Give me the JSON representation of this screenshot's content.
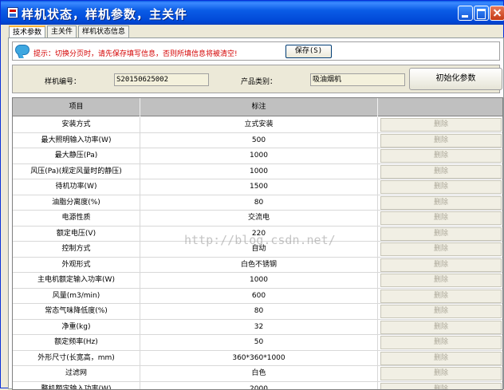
{
  "window": {
    "title": "样机状态，样机参数，主关件"
  },
  "tabs": [
    {
      "label": "技术参数"
    },
    {
      "label": "主关件"
    },
    {
      "label": "样机状态信息"
    }
  ],
  "notice": {
    "text": "提示：切换分页时，请先保存填写信息，否则所填信息将被清空!",
    "save_label": "保存(S)"
  },
  "info": {
    "sample_label": "样机编号：",
    "sample_value": "S20150625002",
    "type_label": "产品类别：",
    "type_value": "吸油烟机",
    "init_label": "初始化参数"
  },
  "table": {
    "headers": [
      "项目",
      "标注",
      ""
    ],
    "delete_label": "删除",
    "rows": [
      [
        "安装方式",
        "立式安装"
      ],
      [
        "最大照明输入功率(W)",
        "500"
      ],
      [
        "最大静压(Pa)",
        "1000"
      ],
      [
        "风压(Pa)(规定风量时的静压)",
        "1000"
      ],
      [
        "待机功率(W)",
        "1500"
      ],
      [
        "油脂分离度(%)",
        "80"
      ],
      [
        "电源性质",
        "交流电"
      ],
      [
        "额定电压(V)",
        "220"
      ],
      [
        "控制方式",
        "自动"
      ],
      [
        "外观形式",
        "白色不锈钢"
      ],
      [
        "主电机额定输入功率(W)",
        "1000"
      ],
      [
        "风量(m3/min)",
        "600"
      ],
      [
        "常态气味降低度(%)",
        "80"
      ],
      [
        "净重(kg)",
        "32"
      ],
      [
        "额定频率(Hz)",
        "50"
      ],
      [
        "外形尺寸(长宽高，mm)",
        "360*360*1000"
      ],
      [
        "过滤网",
        "白色"
      ],
      [
        "整机额定输入功率(W)",
        "2000"
      ]
    ]
  },
  "watermark": "http://blog.csdn.net/"
}
